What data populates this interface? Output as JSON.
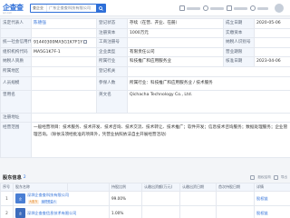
{
  "header": {
    "logo": "企查查",
    "logo_sub": "qcc.com",
    "search_type": "查企业",
    "search_value": "广东企查查科技有限公司",
    "nav": [
      "应用",
      "",
      "",
      ""
    ]
  },
  "info": {
    "rows": [
      {
        "k1": "法定代表人",
        "v1": "陈德强",
        "k2": "登记状态",
        "v2": "存续（在营、开业、在册）",
        "k3": "成立日期",
        "v3": "2020-05-06"
      },
      {
        "k1": "",
        "v1": "",
        "k2": "注册资本",
        "v2": "1000万元",
        "k3": "实缴资本",
        "v3": ""
      },
      {
        "k1": "统一社会信用代码",
        "v1": "91440300MA5G1K7F1Y",
        "k2": "工商注册号",
        "v2": "",
        "k3": "纳税人识别号",
        "v3": ""
      },
      {
        "k1": "组织机构代码",
        "v1": "MA5G1K7F-1",
        "k2": "企业类型",
        "v2": "有限责任公司",
        "k3": "营业期限",
        "v3": ""
      },
      {
        "k1": "纳税人资质",
        "v1": "",
        "k2": "所属行业",
        "v2": "科技推广和应用服务业",
        "k3": "核准日期",
        "v3": "2023-04-06"
      },
      {
        "k1": "所属地区",
        "v1": "",
        "k2": "登记机关",
        "v2": "",
        "k3": "",
        "v3": ""
      },
      {
        "k1": "人员规模",
        "v1": "",
        "k2": "参保人数",
        "v2": "",
        "k3": "",
        "v3": ""
      },
      {
        "k1": "曾用名",
        "v1": "",
        "k2": "英文名",
        "v2": "Qichacha Technology Co., Ltd.",
        "k3": "",
        "v3": ""
      },
      {
        "k1": "注册地址",
        "v1": "",
        "k2": "",
        "v2": "",
        "k3": "",
        "v3": ""
      },
      {
        "k1": "经营范围",
        "v1": "",
        "k2": "",
        "v2": "",
        "k3": "",
        "v3": ""
      }
    ],
    "industry_detail": "所属行业：科技推广和应用服务业 / 技术服务",
    "scope_text": "一般经营项目：技术服务、技术开发、技术咨询、技术交流、技术转让、技术推广；软件开发；信息技术咨询服务；数据处理服务；企业管理咨询。（除依法须经批准的项目外，凭营业执照依法自主开展经营活动）"
  },
  "shareholders": {
    "title": "股东信息",
    "count": "2",
    "tools": [
      "股权结构",
      "导出"
    ],
    "columns": [
      "序号",
      "股东名称",
      "",
      "持股比例",
      "认缴出资额(万元)",
      "认缴出资日期",
      "首次持股日期",
      "详情"
    ],
    "rows": [
      {
        "idx": "1",
        "logo": "企",
        "name": "深圳企查查科技有限公司",
        "tag1": "大股东",
        "tag2": "最终受益人",
        "ratio": "99.00%",
        "amount": "",
        "date1": "",
        "date2": "",
        "detail": "股权链"
      },
      {
        "idx": "2",
        "logo": "企",
        "name": "深圳企查查信息技术有限公司",
        "tag1": "",
        "tag2": "",
        "ratio": "1.00%",
        "amount": "",
        "date1": "",
        "date2": "",
        "detail": "股权链"
      }
    ]
  },
  "colors": {
    "accent": "#2e6fd8",
    "label_bg": "#f2f6fc"
  }
}
